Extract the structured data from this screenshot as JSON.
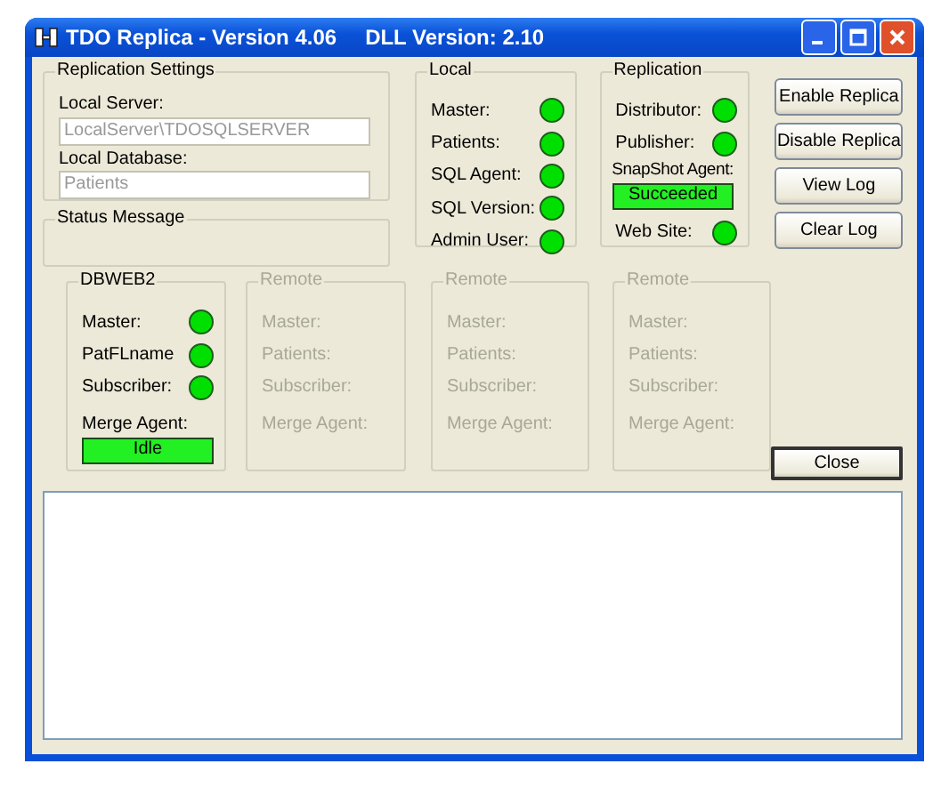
{
  "window": {
    "title": "TDO Replica - Version 4.06",
    "subtitle": "DLL Version: 2.10"
  },
  "replication_settings": {
    "title": "Replication Settings",
    "fields": [
      {
        "label": "Local Server:",
        "value": "LocalServer\\TDOSQLSERVER",
        "disabled": true
      },
      {
        "label": "Local Database:",
        "value": "Patients",
        "disabled": true
      }
    ]
  },
  "status_message": {
    "title": "Status Message"
  },
  "local": {
    "title": "Local",
    "items": [
      {
        "kind": "indicator",
        "label": "Master:",
        "on": true
      },
      {
        "kind": "indicator",
        "label": "Patients:",
        "on": true
      },
      {
        "kind": "indicator",
        "label": "SQL Agent:",
        "on": true
      },
      {
        "kind": "indicator",
        "label": "SQL Version:",
        "on": true
      },
      {
        "kind": "indicator",
        "label": "Admin User:",
        "on": true
      }
    ]
  },
  "replication": {
    "title": "Replication",
    "items": [
      {
        "kind": "indicator",
        "label": "Distributor:",
        "on": true
      },
      {
        "kind": "indicator",
        "label": "Publisher:",
        "on": true
      },
      {
        "kind": "status",
        "label": "SnapShot Agent:",
        "value": "Succeeded",
        "ok": true
      },
      {
        "kind": "indicator",
        "label": "Web Site:",
        "on": true
      }
    ]
  },
  "buttons": [
    "Enable Replica",
    "Disable Replica",
    "View Log",
    "Clear Log"
  ],
  "servers": [
    {
      "title": "DBWEB2",
      "disabled": false,
      "items": [
        {
          "kind": "indicator",
          "label": "Master:",
          "on": true
        },
        {
          "kind": "indicator",
          "label": "PatFLname",
          "on": true
        },
        {
          "kind": "indicator",
          "label": "Subscriber:",
          "on": true
        },
        {
          "kind": "status",
          "label": "Merge Agent:",
          "value": "Idle",
          "ok": true
        }
      ]
    },
    {
      "title": "Remote",
      "disabled": true,
      "items": [
        {
          "kind": "indicator",
          "label": "Master:"
        },
        {
          "kind": "indicator",
          "label": "Patients:"
        },
        {
          "kind": "indicator",
          "label": "Subscriber:"
        },
        {
          "kind": "status",
          "label": "Merge Agent:"
        }
      ]
    },
    {
      "title": "Remote",
      "disabled": true,
      "items": [
        {
          "kind": "indicator",
          "label": "Master:"
        },
        {
          "kind": "indicator",
          "label": "Patients:"
        },
        {
          "kind": "indicator",
          "label": "Subscriber:"
        },
        {
          "kind": "status",
          "label": "Merge Agent:"
        }
      ]
    },
    {
      "title": "Remote",
      "disabled": true,
      "items": [
        {
          "kind": "indicator",
          "label": "Master:"
        },
        {
          "kind": "indicator",
          "label": "Patients:"
        },
        {
          "kind": "indicator",
          "label": "Subscriber:"
        },
        {
          "kind": "status",
          "label": "Merge Agent:"
        }
      ]
    }
  ],
  "close_button": "Close"
}
